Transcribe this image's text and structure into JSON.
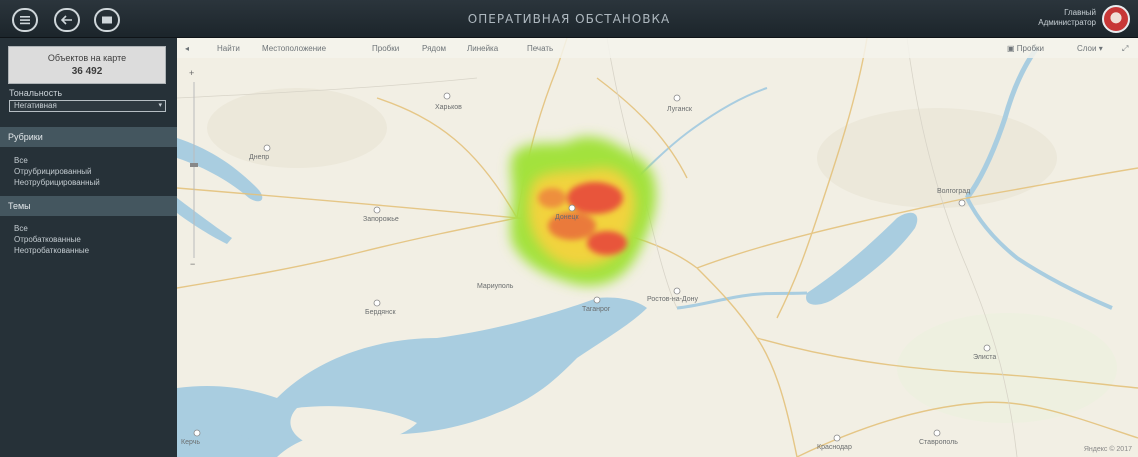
{
  "header": {
    "title": "ОПЕРАТИВНАЯ ОБСТАНОВКА",
    "user_line1": "Главный",
    "user_line2": "Администратор"
  },
  "sidebar": {
    "objects_label": "Объектов на карте",
    "objects_count": "36 492",
    "tonality_label": "Тональность",
    "tonality_value": "Негативная",
    "rubrics_header": "Рубрики",
    "rubric_items": [
      "Все",
      "Отрубрицированный",
      "Неотрубрицированный"
    ],
    "themes_header": "Темы",
    "theme_items": [
      "Все",
      "Отробаткованные",
      "Неотробаткованные"
    ]
  },
  "map": {
    "toolbar": [
      "Найти",
      "Местоположение",
      "Пробки",
      "Рядом",
      "Линейка",
      "Печать"
    ],
    "scheme_label": "Пробки",
    "layers_label": "Слои",
    "places": [
      "Харьков",
      "Луганск",
      "Донецк",
      "Мариуполь",
      "Ростов-на-Дону",
      "Днепр",
      "Запорожье",
      "Волгоград",
      "Бердянск",
      "Таганрог",
      "Краснодар",
      "Ставрополь",
      "Элиста",
      "Керчь"
    ],
    "copyright": "Яндекс © 2017"
  },
  "colors": {
    "topbar": "#1c252b",
    "sidebar": "#263138",
    "section_header": "#44565f",
    "water": "#a9cde0",
    "land": "#f2efe4",
    "heat_low": "#a3e23c",
    "heat_mid": "#f2b33c",
    "heat_high": "#e8553a"
  }
}
